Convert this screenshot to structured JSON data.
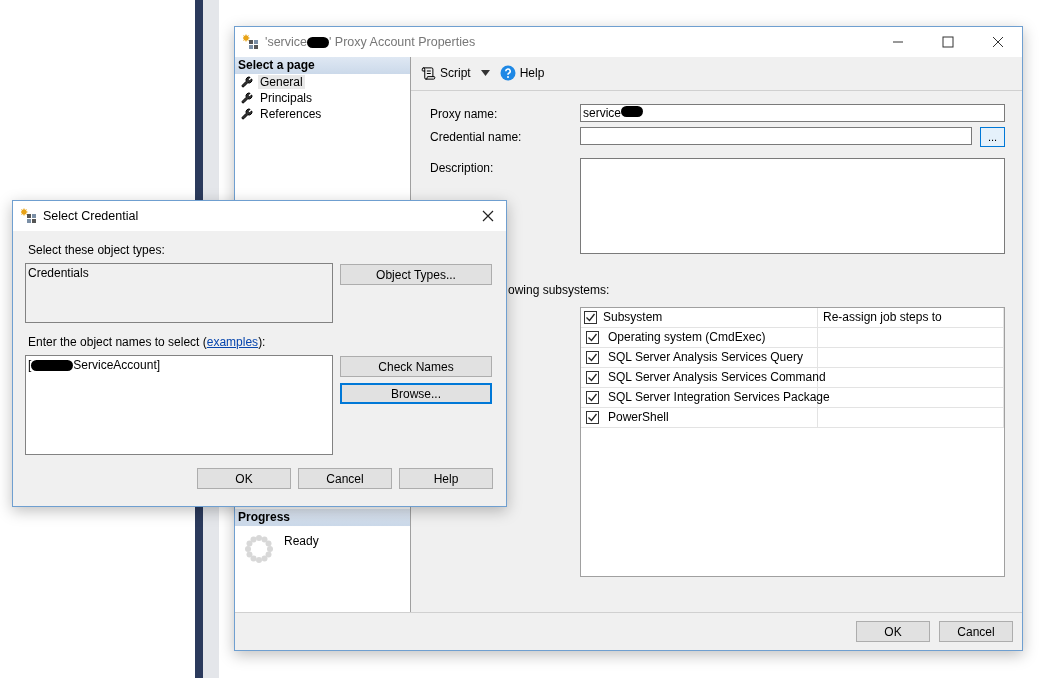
{
  "proxy_window": {
    "title_before": "'service",
    "title_redacted": true,
    "title_after": "' Proxy Account Properties",
    "select_page": {
      "heading": "Select a page",
      "items": [
        {
          "label": "General",
          "selected": true
        },
        {
          "label": "Principals",
          "selected": false
        },
        {
          "label": "References",
          "selected": false
        }
      ]
    },
    "toolbar": {
      "script": "Script",
      "help": "Help"
    },
    "fields": [
      {
        "kind": "text",
        "label": "Proxy name:",
        "value": "service",
        "redacted": true
      },
      {
        "kind": "browse",
        "label": "Credential name:",
        "button": "..."
      },
      {
        "kind": "textarea",
        "label": "Description:"
      }
    ],
    "subsystems": {
      "label": "owing subsystems:",
      "columns": [
        "Subsystem",
        "Re-assign job steps to"
      ],
      "all_checked": true,
      "rows": [
        {
          "name": "Operating system (CmdExec)",
          "checked": true
        },
        {
          "name": "SQL Server Analysis Services Query",
          "checked": true
        },
        {
          "name": "SQL Server Analysis Services Command",
          "checked": true
        },
        {
          "name": "SQL Server Integration Services Package",
          "checked": true
        },
        {
          "name": "PowerShell",
          "checked": true
        }
      ]
    },
    "progress": {
      "heading": "Progress",
      "status": "Ready"
    },
    "buttons": [
      "OK",
      "Cancel"
    ]
  },
  "credential_dialog": {
    "title": "Select Credential",
    "types_label": "Select these object types:",
    "types": "Credentials",
    "object_types_button": "Object Types...",
    "names_label_before": "Enter the object names to select (",
    "names_link": "examples",
    "names_label_after": "):",
    "names_before": "[",
    "names_redacted": true,
    "names_after": "ServiceAccount]",
    "side_buttons": [
      {
        "label": "Check Names",
        "focused": false
      },
      {
        "label": "Browse...",
        "focused": true
      }
    ],
    "buttons": [
      "OK",
      "Cancel",
      "Help"
    ]
  }
}
